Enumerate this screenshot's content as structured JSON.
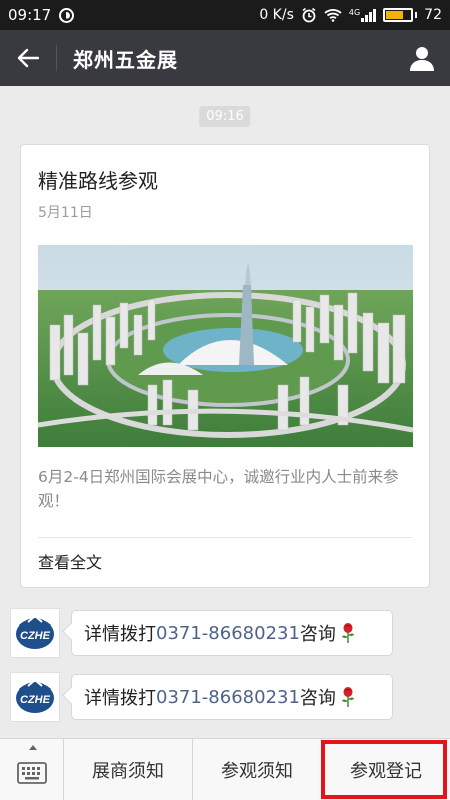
{
  "status_bar": {
    "time": "09:17",
    "network_speed": "0 K/s",
    "signal_label": "4G",
    "battery": "72",
    "battery_level": 0.72
  },
  "nav": {
    "title": "郑州五金展"
  },
  "chat": {
    "timestamp": "09:16",
    "article": {
      "title": "精准路线参观",
      "date": "5月11日",
      "description": "6月2-4日郑州国际会展中心，诚邀行业内人士前来参观！",
      "read_more": "查看全文"
    },
    "messages": [
      {
        "prefix": "详情拨打 ",
        "phone": "0371-86680231",
        "suffix": "咨询",
        "avatar_text": "CZHE",
        "emoji": "rose-icon"
      },
      {
        "prefix": "详情拨打 ",
        "phone": "0371-86680231",
        "suffix": "咨询",
        "avatar_text": "CZHE",
        "emoji": "rose-icon"
      }
    ]
  },
  "bottom_menu": {
    "items": [
      {
        "label": "展商须知"
      },
      {
        "label": "参观须知"
      },
      {
        "label": "参观登记"
      }
    ],
    "highlight_color": "#e5131a"
  },
  "colors": {
    "nav_bg": "#393a3f",
    "chat_bg": "#ebebeb",
    "phone_link": "#4e6487",
    "battery_fill": "#f2b10b"
  }
}
